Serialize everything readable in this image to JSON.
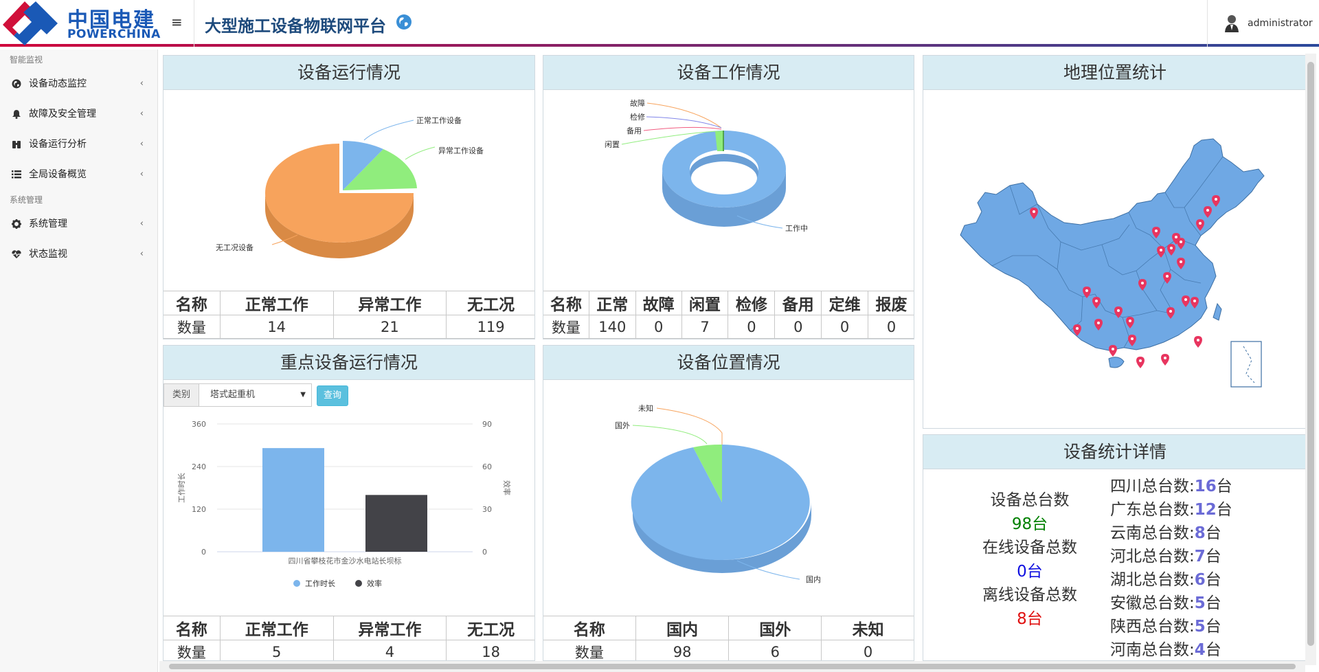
{
  "header": {
    "logo_cn": "中国电建",
    "logo_en": "POWERCHINA",
    "title": "大型施工设备物联网平台",
    "user": "administrator"
  },
  "sidebar": {
    "section1": "智能监视",
    "section2": "系统管理",
    "items": [
      {
        "label": "设备动态监控",
        "icon": "globe-icon"
      },
      {
        "label": "故障及安全管理",
        "icon": "bell-icon"
      },
      {
        "label": "设备运行分析",
        "icon": "binoculars-icon"
      },
      {
        "label": "全局设备概览",
        "icon": "list-icon"
      },
      {
        "label": "系统管理",
        "icon": "gear-icon"
      },
      {
        "label": "状态监视",
        "icon": "heartbeat-icon"
      }
    ]
  },
  "panels": {
    "run_status": {
      "title": "设备运行情况",
      "table_headers": [
        "名称",
        "正常工作",
        "异常工作",
        "无工况"
      ],
      "table_values": [
        "数量",
        "14",
        "21",
        "119"
      ]
    },
    "work_status": {
      "title": "设备工作情况",
      "table_headers": [
        "名称",
        "正常",
        "故障",
        "闲置",
        "检修",
        "备用",
        "定维",
        "报废"
      ],
      "table_values": [
        "数量",
        "140",
        "0",
        "7",
        "0",
        "0",
        "0",
        "0"
      ]
    },
    "geo": {
      "title": "地理位置统计"
    },
    "key_equipment": {
      "title": "重点设备运行情况",
      "filter_label": "类别",
      "filter_value": "塔式起重机",
      "query_label": "查询",
      "table_headers": [
        "名称",
        "正常工作",
        "异常工作",
        "无工况"
      ],
      "table_values": [
        "数量",
        "5",
        "4",
        "18"
      ]
    },
    "location": {
      "title": "设备位置情况",
      "table_headers": [
        "名称",
        "国内",
        "国外",
        "未知"
      ],
      "table_values": [
        "数量",
        "98",
        "6",
        "0"
      ]
    },
    "stats_detail": {
      "title": "设备统计详情",
      "total_label": "设备总台数",
      "total_value": "98台",
      "online_label": "在线设备总数",
      "online_value": "0台",
      "offline_label": "离线设备总数",
      "offline_value": "8台",
      "provinces": [
        {
          "label": "四川总台数:",
          "count": "16",
          "unit": "台"
        },
        {
          "label": "广东总台数:",
          "count": "12",
          "unit": "台"
        },
        {
          "label": "云南总台数:",
          "count": "8",
          "unit": "台"
        },
        {
          "label": "河北总台数:",
          "count": "7",
          "unit": "台"
        },
        {
          "label": "湖北总台数:",
          "count": "6",
          "unit": "台"
        },
        {
          "label": "安徽总台数:",
          "count": "5",
          "unit": "台"
        },
        {
          "label": "陕西总台数:",
          "count": "5",
          "unit": "台"
        },
        {
          "label": "河南总台数:",
          "count": "4",
          "unit": "台"
        }
      ]
    }
  },
  "colors": {
    "blue": "#7cb5ec",
    "green": "#90ed7d",
    "orange": "#f7a35c",
    "dark": "#434348",
    "marker": "#e8355f",
    "map": "#6fa8e4"
  },
  "chart_data": [
    {
      "type": "pie",
      "labels": [
        "正常工作设备",
        "异常工作设备",
        "无工况设备"
      ],
      "values": [
        14,
        21,
        119
      ]
    },
    {
      "type": "pie",
      "labels": [
        "工作中",
        "闲置",
        "备用",
        "检修",
        "故障"
      ],
      "values": [
        140,
        7,
        0,
        0,
        0
      ]
    },
    {
      "type": "bar",
      "categories": [
        "四川省攀枝花市金沙水电站长坝标"
      ],
      "series": [
        {
          "name": "工作时长",
          "values": [
            292
          ]
        },
        {
          "name": "效率",
          "values": [
            40
          ]
        }
      ],
      "ylabel": "工作时长",
      "ylabel_right": "效率",
      "ylim": [
        0,
        360
      ],
      "ylim_right": [
        0,
        90
      ],
      "yticks": [
        "360",
        "240",
        "120",
        "0"
      ],
      "yticks_right": [
        "90",
        "60",
        "30",
        "0"
      ]
    },
    {
      "type": "pie",
      "labels": [
        "国内",
        "国外",
        "未知"
      ],
      "values": [
        98,
        6,
        0
      ]
    }
  ]
}
